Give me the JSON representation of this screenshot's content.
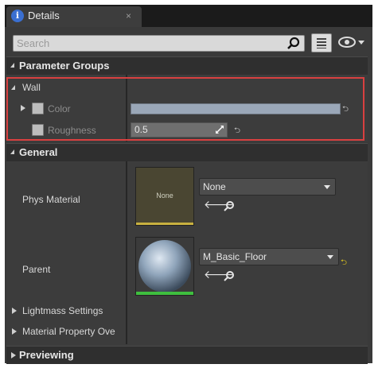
{
  "tab": {
    "title": "Details",
    "close": "×",
    "icon": "info-icon"
  },
  "search": {
    "placeholder": "Search"
  },
  "sections": {
    "parameter_groups": "Parameter Groups",
    "general": "General",
    "previewing": "Previewing"
  },
  "wall": {
    "label": "Wall",
    "color_label": "Color",
    "roughness_label": "Roughness",
    "roughness_value": "0.5"
  },
  "general": {
    "phys_material_label": "Phys Material",
    "phys_material_thumb": "None",
    "phys_material_value": "None",
    "parent_label": "Parent",
    "parent_value": "M_Basic_Floor",
    "lightmass_label": "Lightmass Settings",
    "material_property_label": "Material Property Ove"
  },
  "colors": {
    "highlight": "#d94040",
    "accent_blue": "#3a6fd1",
    "thumb_line_yellow": "#c8b040",
    "thumb_line_green": "#3fbf3f"
  }
}
